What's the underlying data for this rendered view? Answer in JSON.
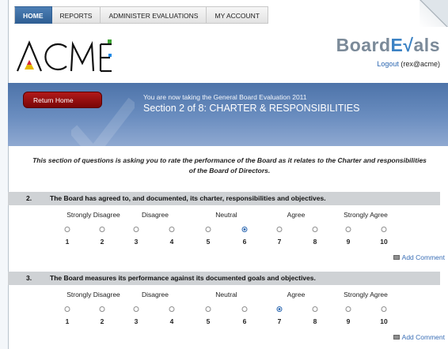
{
  "nav": {
    "tabs": [
      {
        "label": "HOME",
        "active": true
      },
      {
        "label": "REPORTS",
        "active": false
      },
      {
        "label": "ADMINISTER EVALUATIONS",
        "active": false
      },
      {
        "label": "MY ACCOUNT",
        "active": false
      }
    ]
  },
  "header": {
    "company_logo_text": "ACME",
    "brand_logo_prefix": "Board",
    "brand_logo_accent": "E",
    "brand_logo_check": "√",
    "brand_logo_suffix": "als",
    "logout_label": "Logout",
    "logout_user": "(rex@acme)"
  },
  "banner": {
    "return_label": "Return Home",
    "subtitle": "You are now taking the General Board Evaluation 2011",
    "title": "Section 2 of 8: CHARTER & RESPONSIBILITIES"
  },
  "intro": "This section of questions is asking you to rate the performance of the Board as it relates to the Charter and responsibilities of the Board of Directors.",
  "scale_labels": [
    "Strongly Disagree",
    "Disagree",
    "Neutral",
    "Agree",
    "Strongly Agree"
  ],
  "scale_numbers": [
    "1",
    "2",
    "3",
    "4",
    "5",
    "6",
    "7",
    "8",
    "9",
    "10"
  ],
  "questions": [
    {
      "number": "2.",
      "text": "The Board has agreed to, and documented, its charter, responsibilities and objectives.",
      "selected": 6
    },
    {
      "number": "3.",
      "text": "The Board measures its performance against its documented goals and objectives.",
      "selected": 7
    }
  ],
  "add_comment_label": "Add Comment",
  "colors": {
    "nav_active": "#2f5f94",
    "banner": "#5f82b8",
    "return_button": "#9c1010",
    "link": "#2a66b0"
  }
}
